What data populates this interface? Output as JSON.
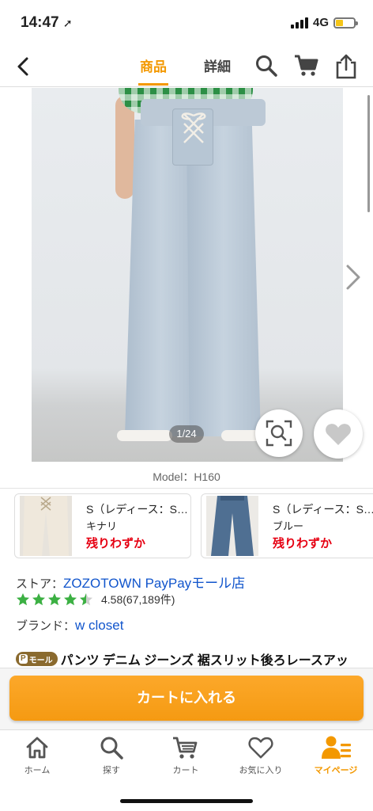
{
  "status_bar": {
    "time": "14:47",
    "network": "4G"
  },
  "nav": {
    "tabs": [
      {
        "label": "商品",
        "active": true
      },
      {
        "label": "詳細",
        "active": false
      }
    ],
    "icons": [
      "back-arrow-icon",
      "search-icon",
      "cart-icon",
      "share-icon"
    ]
  },
  "gallery": {
    "page_indicator": "1/24",
    "caption": "Model：H160"
  },
  "variants": [
    {
      "name": "S（レディース：S…",
      "color": "キナリ",
      "stock": "残りわずか"
    },
    {
      "name": "S（レディース：S…",
      "color": "ブルー",
      "stock": "残りわずか"
    }
  ],
  "store": {
    "label": "ストア：",
    "name": "ZOZOTOWN PayPayモール店"
  },
  "rating": {
    "stars": 4.5,
    "text": "4.58(67,189件)"
  },
  "brand": {
    "label": "ブランド：",
    "name": "w closet"
  },
  "product": {
    "badge": "モール",
    "title": "パンツ デニム ジーンズ 裾スリット後ろレースアッ"
  },
  "cart": {
    "button_label": "カートに入れる"
  },
  "tabbar": {
    "items": [
      {
        "label": "ホーム"
      },
      {
        "label": "探す"
      },
      {
        "label": "カート"
      },
      {
        "label": "お気に入り"
      },
      {
        "label": "マイページ"
      }
    ]
  },
  "colors": {
    "accent": "#f39800",
    "link": "#1155cc",
    "stock_red": "#e60012",
    "star_green": "#3cb043"
  }
}
